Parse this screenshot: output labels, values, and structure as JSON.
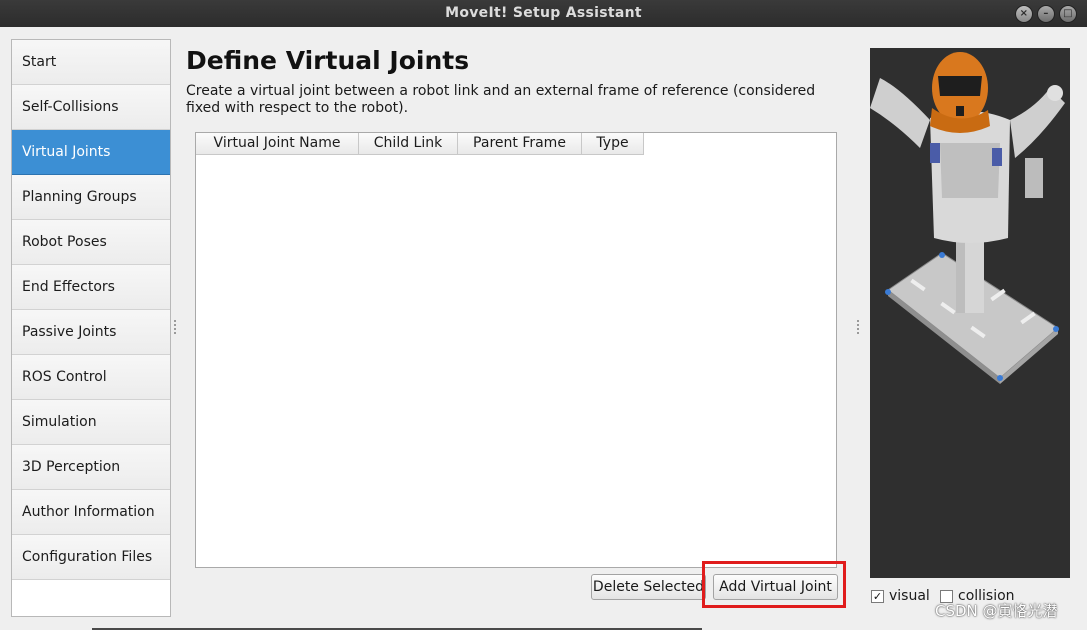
{
  "window": {
    "title": "MoveIt! Setup Assistant",
    "controls": [
      "×",
      "–",
      "□"
    ]
  },
  "sidebar": {
    "active_index": 2,
    "items": [
      {
        "label": "Start"
      },
      {
        "label": "Self-Collisions"
      },
      {
        "label": "Virtual Joints"
      },
      {
        "label": "Planning Groups"
      },
      {
        "label": "Robot Poses"
      },
      {
        "label": "End Effectors"
      },
      {
        "label": "Passive Joints"
      },
      {
        "label": "ROS Control"
      },
      {
        "label": "Simulation"
      },
      {
        "label": "3D Perception"
      },
      {
        "label": "Author Information"
      },
      {
        "label": "Configuration Files"
      }
    ]
  },
  "main": {
    "title": "Define Virtual Joints",
    "description": "Create a virtual joint between a robot link and an external frame of reference (considered fixed with respect to the robot).",
    "table": {
      "columns": [
        "Virtual Joint Name",
        "Child Link",
        "Parent Frame",
        "Type"
      ],
      "rows": []
    },
    "buttons": {
      "delete_label": "Delete Selected",
      "add_label": "Add Virtual Joint"
    }
  },
  "viewer": {
    "visual_label": "visual",
    "visual_checked": true,
    "collision_label": "collision",
    "collision_checked": false
  },
  "watermark": "CSDN @寅恪光潜",
  "colors": {
    "active_item": "#3c8fd4",
    "highlight_box": "#e01c1c",
    "robot_head": "#d9781e",
    "viewer_bg": "#2f2f2f"
  }
}
